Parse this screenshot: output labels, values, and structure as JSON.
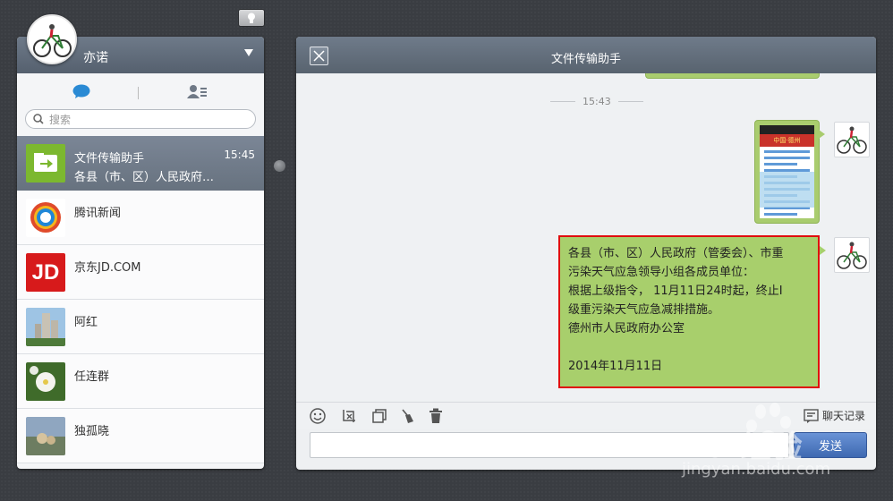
{
  "user": {
    "name": "亦诺"
  },
  "search": {
    "placeholder": "搜索"
  },
  "conversations": [
    {
      "name": "文件传输助手",
      "time": "15:45",
      "preview": "各县（市、区）人民政府…"
    },
    {
      "name": "腾讯新闻"
    },
    {
      "name": "京东JD.COM"
    },
    {
      "name": "阿红"
    },
    {
      "name": "任连群"
    },
    {
      "name": "独孤晓"
    }
  ],
  "icons": {
    "jd": "JD",
    "image_banner": "中国·德州"
  },
  "chat": {
    "title": "文件传输助手",
    "timestamp": "15:43",
    "message_lines": [
      "各县（市、区）人民政府（管委会）、市重",
      "污染天气应急领导小组各成员单位：",
      "根据上级指令，  11月11日24时起，终止Ⅰ",
      "级重污染天气应急减排措施。",
      "德州市人民政府办公室",
      "",
      "2014年11月11日"
    ]
  },
  "toolbar": {
    "history_label": "聊天记录"
  },
  "send": {
    "label": "发送"
  },
  "watermark": {
    "brand": "Bai经验",
    "url": "jingyan.baidu.com"
  },
  "colors": {
    "bubble_green": "#a8cf6c",
    "highlight_red": "#e00d0d",
    "header_slate": "#5f6a78",
    "send_blue": "#4a74bc"
  }
}
